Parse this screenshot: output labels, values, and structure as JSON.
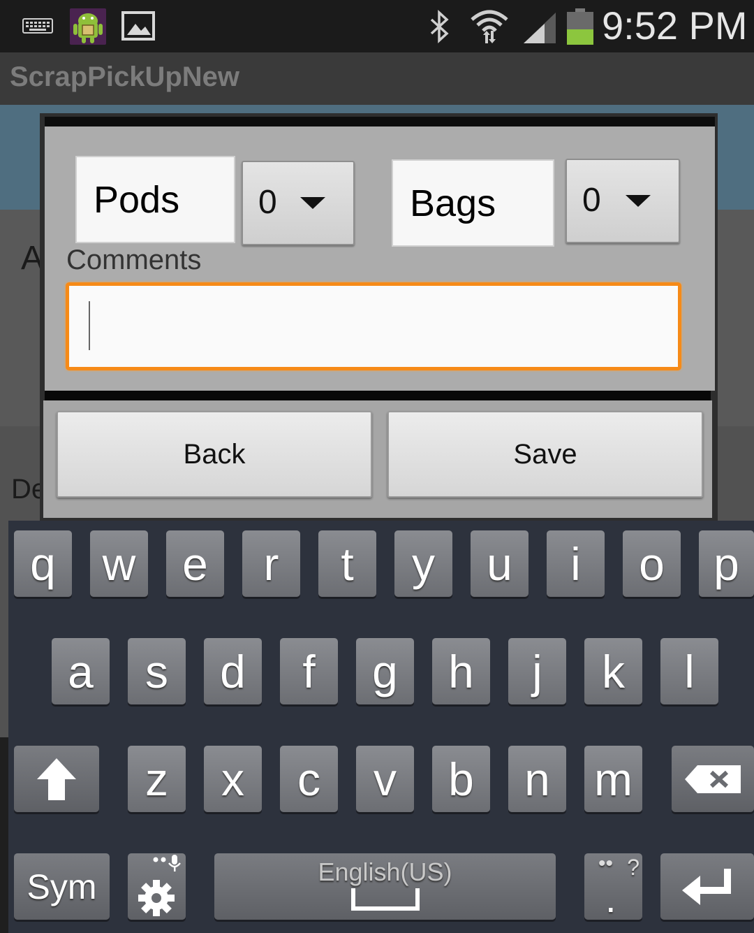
{
  "status_bar": {
    "time": "9:52 PM",
    "icons": [
      "keyboard-icon",
      "android-app-icon",
      "image-icon",
      "bluetooth-icon",
      "wifi-icon",
      "signal-icon",
      "battery-icon"
    ]
  },
  "app": {
    "title": "ScrapPickUpNew",
    "background_fragments": [
      "A",
      "De"
    ]
  },
  "dialog": {
    "pods_label": "Pods",
    "pods_value": "0",
    "bags_label": "Bags",
    "bags_value": "0",
    "comments_label": "Comments",
    "comments_value": "",
    "back_label": "Back",
    "save_label": "Save",
    "accent_color": "#f68a17"
  },
  "keyboard": {
    "row1": [
      "q",
      "w",
      "e",
      "r",
      "t",
      "y",
      "u",
      "i",
      "o",
      "p"
    ],
    "row2": [
      "a",
      "s",
      "d",
      "f",
      "g",
      "h",
      "j",
      "k",
      "l"
    ],
    "row3": [
      "z",
      "x",
      "c",
      "v",
      "b",
      "n",
      "m"
    ],
    "sym_label": "Sym",
    "space_label": "English(US)",
    "period_label": ".",
    "period_hint": "?"
  }
}
